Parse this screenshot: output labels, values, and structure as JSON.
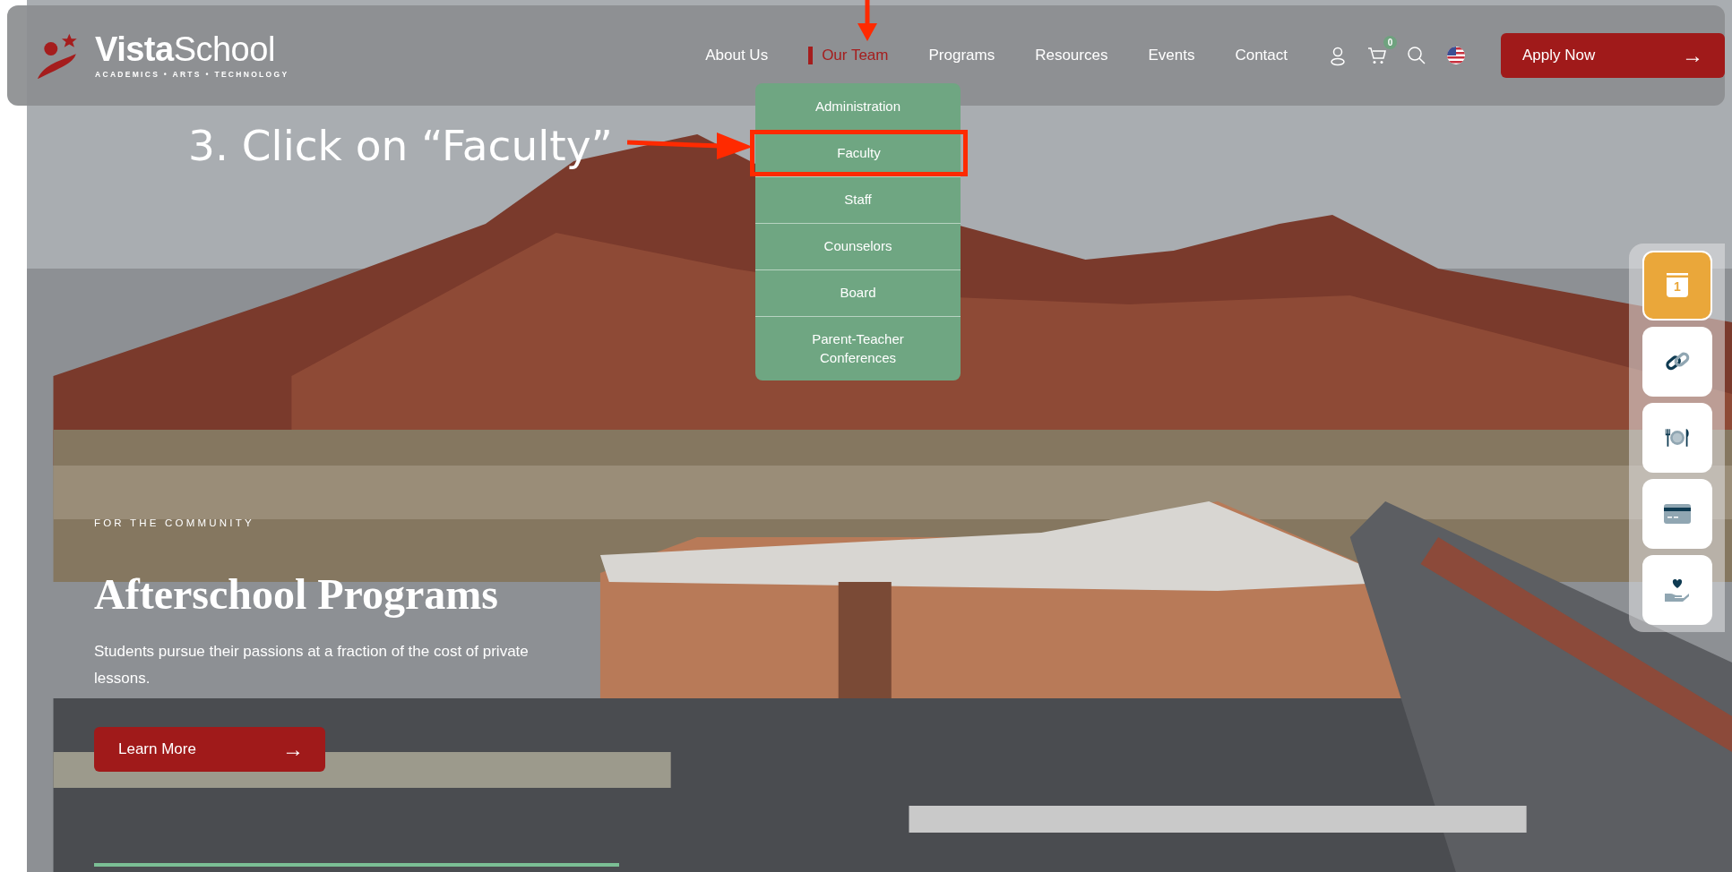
{
  "header": {
    "logo": {
      "name": "**Vista**School",
      "tagline": "ACADEMICS • ARTS • TECHNOLOGY"
    },
    "nav": [
      {
        "label": "About Us",
        "selected": false
      },
      {
        "label": "Our Team",
        "selected": true
      },
      {
        "label": "Programs",
        "selected": false
      },
      {
        "label": "Resources",
        "selected": false
      },
      {
        "label": "Events",
        "selected": false
      },
      {
        "label": "Contact",
        "selected": false
      }
    ],
    "cart_count": "0",
    "apply_button": {
      "label": "Apply Now",
      "arrow": "→"
    }
  },
  "dropdown": [
    {
      "label": "Administration",
      "highlighted": false
    },
    {
      "label": "Faculty",
      "highlighted": true
    },
    {
      "label": "Staff",
      "highlighted": false
    },
    {
      "label": "Counselors",
      "highlighted": false
    },
    {
      "label": "Board",
      "highlighted": false
    },
    {
      "label": "Parent-Teacher Conferences",
      "highlighted": false
    }
  ],
  "annotation": {
    "text": "3. Click on “Faculty”"
  },
  "quick_links": {
    "calendar_day": "1"
  },
  "hero": {
    "eyebrow": "FOR THE COMMUNITY",
    "title": "Afterschool Programs",
    "text": "Students pursue their passions at a fraction of the cost of private lessons.",
    "button": {
      "label": "Learn More",
      "arrow": "→"
    }
  }
}
